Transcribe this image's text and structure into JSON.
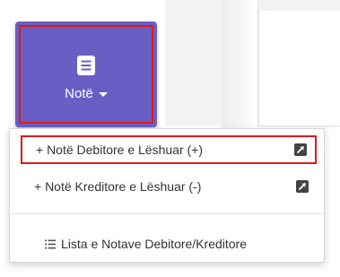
{
  "note_button": {
    "label": "Notë",
    "icon": "note-document-icon",
    "color": "#6a5ec5",
    "highlight_color": "#e01a1a"
  },
  "dropdown": {
    "items": [
      {
        "label": "+ Notë Debitore e Lëshuar (+)",
        "icon": "external-link-icon",
        "highlighted": true
      },
      {
        "label": "+ Notë Kreditore e Lëshuar (-)",
        "icon": "external-link-icon",
        "highlighted": false
      },
      {
        "label": "Lista e Notave Debitore/Kreditore",
        "icon": "list-icon",
        "highlighted": false
      }
    ]
  }
}
